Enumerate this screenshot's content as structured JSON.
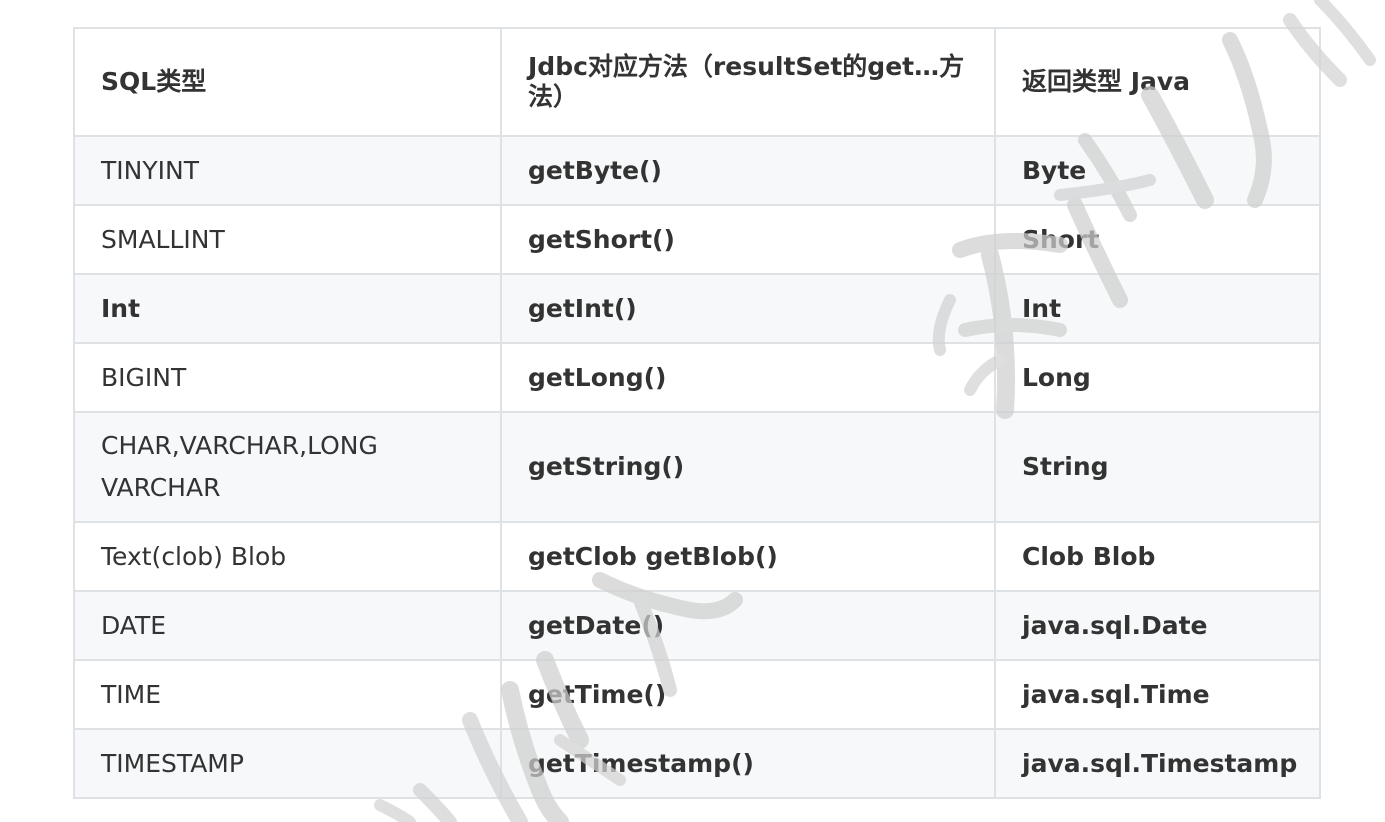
{
  "table": {
    "headers": [
      "SQL类型",
      "Jdbc对应方法（resultSet的get…方法）",
      "返回类型 Java"
    ],
    "rows": [
      [
        "TINYINT",
        "getByte()",
        "Byte"
      ],
      [
        "SMALLINT",
        "getShort()",
        "Short"
      ],
      [
        "Int",
        "getInt()",
        "Int"
      ],
      [
        "BIGINT",
        "getLong()",
        "Long"
      ],
      [
        "CHAR,VARCHAR,LONG VARCHAR",
        "getString()",
        "String"
      ],
      [
        "Text(clob) Blob",
        "getClob getBlob()",
        "Clob Blob"
      ],
      [
        "DATE",
        "getDate()",
        "java.sql.Date"
      ],
      [
        "TIME",
        "getTime()",
        "java.sql.Time"
      ],
      [
        "TIMESTAMP",
        "getTimestamp()",
        "java.sql.Timestamp"
      ]
    ]
  },
  "colors": {
    "border": "#dfe2e5",
    "stripe": "#f6f8fa",
    "text": "#333333",
    "watermark": "#cfcfcf"
  }
}
